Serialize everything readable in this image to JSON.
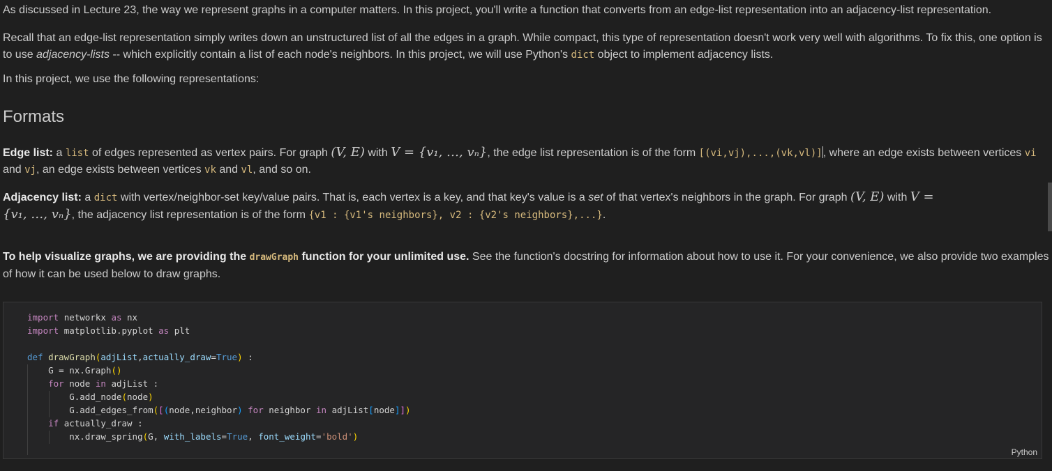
{
  "paragraphs": {
    "p1": "As discussed in Lecture 23, the way we represent graphs in a computer matters. In this project, you'll write a function that converts from an edge-list representation into an adjacency-list representation.",
    "p2_a": "Recall that an edge-list representation simply writes down an unstructured list of all the edges in a graph. While compact, this type of representation doesn't work very well with algorithms. To fix this, one option is to use ",
    "p2_em": "adjacency-lists",
    "p2_b": " -- which explicitly contain a list of each node's neighbors. In this project, we will use Python's ",
    "p2_code": "dict",
    "p2_c": " object to implement adjacency lists.",
    "p3": "In this project, we use the following representations:"
  },
  "heading": "Formats",
  "edge_list": {
    "label": "Edge list:",
    "t1": " a ",
    "code1": "list",
    "t2": " of edges represented as vertex pairs. For graph ",
    "math1": "(V, E)",
    "t3": " with ",
    "math2": "V = {v₁, …, vₙ}",
    "t4": ", the edge list representation is of the form ",
    "code2": "[(vi,vj),...,(vk,vl)]",
    "t5": ", where an edge exists between vertices ",
    "code3": "vi",
    "t6": " and ",
    "code4": "vj",
    "t7": ", an edge exists between vertices ",
    "code5": "vk",
    "t8": " and ",
    "code6": "vl",
    "t9": ", and so on."
  },
  "adjacency_list": {
    "label": "Adjacency list:",
    "t1": " a ",
    "code1": "dict",
    "t2": " with vertex/neighbor-set key/value pairs. That is, each vertex is a key, and that key's value is a ",
    "em": "set",
    "t3": " of that vertex's neighbors in the graph. For graph ",
    "math1": "(V, E)",
    "t4": " with ",
    "math2a": "V =",
    "math2b": "{v₁, …, vₙ}",
    "t5": ", the adjacency list representation is of the form ",
    "code2": "{v1 : {v1's neighbors}, v2 : {v2's neighbors},...}",
    "t6": "."
  },
  "visualize": {
    "bold_a": "To help visualize graphs, we are providing the ",
    "code": "drawGraph",
    "bold_b": " function for your unlimited use.",
    "rest": " See the function's docstring for information about how to use it. For your convenience, we also provide two examples of how it can be used below to draw graphs."
  },
  "code_cell": {
    "language": "Python",
    "tokens": {
      "import": "import",
      "as": "as",
      "def": "def",
      "for": "for",
      "in": "in",
      "if": "if",
      "True": "True",
      "networkx": "networkx",
      "nx": "nx",
      "matplotlib": "matplotlib.pyplot",
      "plt": "plt",
      "drawGraph": "drawGraph",
      "adjList": "adjList",
      "actually_draw": "actually_draw",
      "G": "G",
      "Graph": "Graph",
      "node": "node",
      "add_node": "add_node",
      "add_edges_from": "add_edges_from",
      "neighbor": "neighbor",
      "draw_spring": "draw_spring",
      "with_labels": "with_labels",
      "font_weight": "font_weight",
      "bold_str": "'bold'"
    }
  }
}
